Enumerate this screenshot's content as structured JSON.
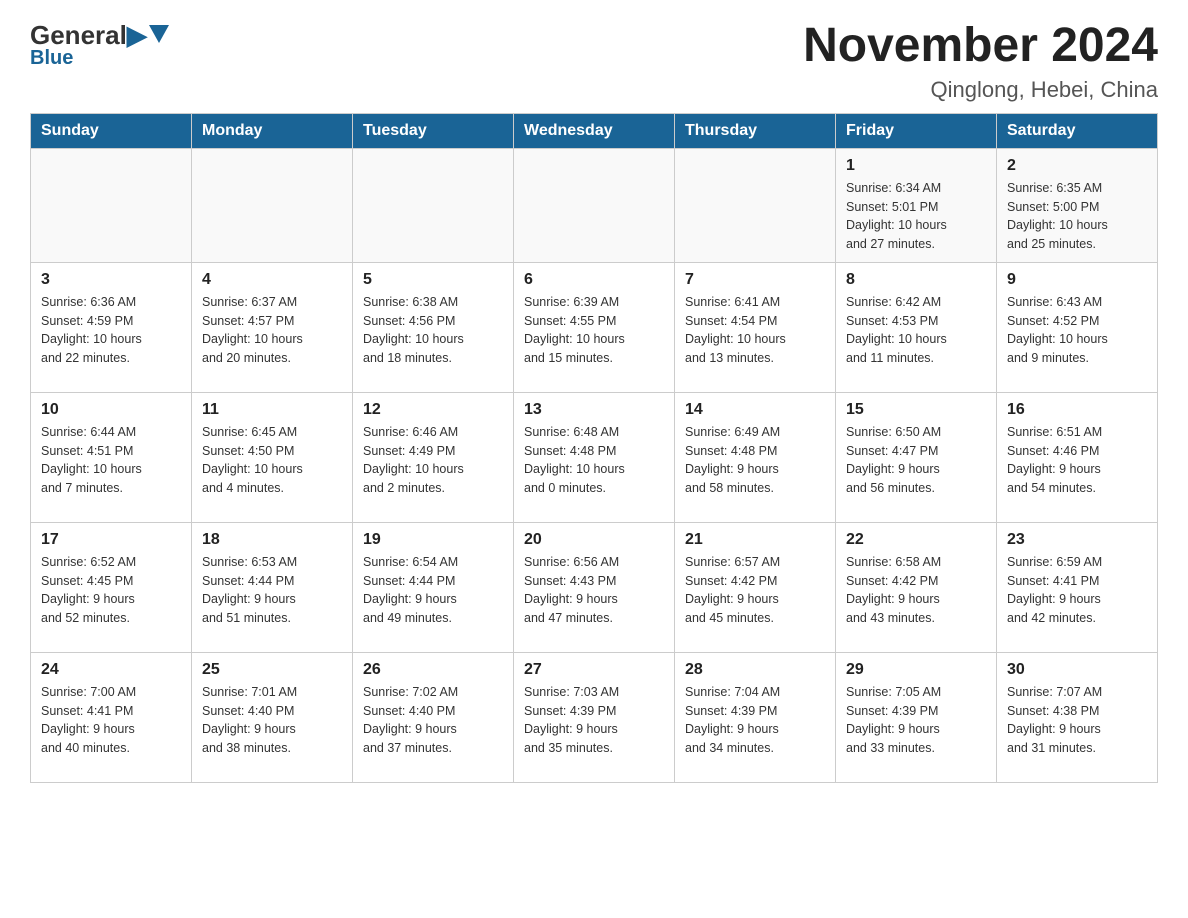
{
  "header": {
    "logo": {
      "general": "General",
      "blue": "Blue",
      "blue_label": "Blue"
    },
    "month_year": "November 2024",
    "location": "Qinglong, Hebei, China"
  },
  "weekdays": [
    "Sunday",
    "Monday",
    "Tuesday",
    "Wednesday",
    "Thursday",
    "Friday",
    "Saturday"
  ],
  "weeks": [
    [
      {
        "day": "",
        "info": ""
      },
      {
        "day": "",
        "info": ""
      },
      {
        "day": "",
        "info": ""
      },
      {
        "day": "",
        "info": ""
      },
      {
        "day": "",
        "info": ""
      },
      {
        "day": "1",
        "info": "Sunrise: 6:34 AM\nSunset: 5:01 PM\nDaylight: 10 hours\nand 27 minutes."
      },
      {
        "day": "2",
        "info": "Sunrise: 6:35 AM\nSunset: 5:00 PM\nDaylight: 10 hours\nand 25 minutes."
      }
    ],
    [
      {
        "day": "3",
        "info": "Sunrise: 6:36 AM\nSunset: 4:59 PM\nDaylight: 10 hours\nand 22 minutes."
      },
      {
        "day": "4",
        "info": "Sunrise: 6:37 AM\nSunset: 4:57 PM\nDaylight: 10 hours\nand 20 minutes."
      },
      {
        "day": "5",
        "info": "Sunrise: 6:38 AM\nSunset: 4:56 PM\nDaylight: 10 hours\nand 18 minutes."
      },
      {
        "day": "6",
        "info": "Sunrise: 6:39 AM\nSunset: 4:55 PM\nDaylight: 10 hours\nand 15 minutes."
      },
      {
        "day": "7",
        "info": "Sunrise: 6:41 AM\nSunset: 4:54 PM\nDaylight: 10 hours\nand 13 minutes."
      },
      {
        "day": "8",
        "info": "Sunrise: 6:42 AM\nSunset: 4:53 PM\nDaylight: 10 hours\nand 11 minutes."
      },
      {
        "day": "9",
        "info": "Sunrise: 6:43 AM\nSunset: 4:52 PM\nDaylight: 10 hours\nand 9 minutes."
      }
    ],
    [
      {
        "day": "10",
        "info": "Sunrise: 6:44 AM\nSunset: 4:51 PM\nDaylight: 10 hours\nand 7 minutes."
      },
      {
        "day": "11",
        "info": "Sunrise: 6:45 AM\nSunset: 4:50 PM\nDaylight: 10 hours\nand 4 minutes."
      },
      {
        "day": "12",
        "info": "Sunrise: 6:46 AM\nSunset: 4:49 PM\nDaylight: 10 hours\nand 2 minutes."
      },
      {
        "day": "13",
        "info": "Sunrise: 6:48 AM\nSunset: 4:48 PM\nDaylight: 10 hours\nand 0 minutes."
      },
      {
        "day": "14",
        "info": "Sunrise: 6:49 AM\nSunset: 4:48 PM\nDaylight: 9 hours\nand 58 minutes."
      },
      {
        "day": "15",
        "info": "Sunrise: 6:50 AM\nSunset: 4:47 PM\nDaylight: 9 hours\nand 56 minutes."
      },
      {
        "day": "16",
        "info": "Sunrise: 6:51 AM\nSunset: 4:46 PM\nDaylight: 9 hours\nand 54 minutes."
      }
    ],
    [
      {
        "day": "17",
        "info": "Sunrise: 6:52 AM\nSunset: 4:45 PM\nDaylight: 9 hours\nand 52 minutes."
      },
      {
        "day": "18",
        "info": "Sunrise: 6:53 AM\nSunset: 4:44 PM\nDaylight: 9 hours\nand 51 minutes."
      },
      {
        "day": "19",
        "info": "Sunrise: 6:54 AM\nSunset: 4:44 PM\nDaylight: 9 hours\nand 49 minutes."
      },
      {
        "day": "20",
        "info": "Sunrise: 6:56 AM\nSunset: 4:43 PM\nDaylight: 9 hours\nand 47 minutes."
      },
      {
        "day": "21",
        "info": "Sunrise: 6:57 AM\nSunset: 4:42 PM\nDaylight: 9 hours\nand 45 minutes."
      },
      {
        "day": "22",
        "info": "Sunrise: 6:58 AM\nSunset: 4:42 PM\nDaylight: 9 hours\nand 43 minutes."
      },
      {
        "day": "23",
        "info": "Sunrise: 6:59 AM\nSunset: 4:41 PM\nDaylight: 9 hours\nand 42 minutes."
      }
    ],
    [
      {
        "day": "24",
        "info": "Sunrise: 7:00 AM\nSunset: 4:41 PM\nDaylight: 9 hours\nand 40 minutes."
      },
      {
        "day": "25",
        "info": "Sunrise: 7:01 AM\nSunset: 4:40 PM\nDaylight: 9 hours\nand 38 minutes."
      },
      {
        "day": "26",
        "info": "Sunrise: 7:02 AM\nSunset: 4:40 PM\nDaylight: 9 hours\nand 37 minutes."
      },
      {
        "day": "27",
        "info": "Sunrise: 7:03 AM\nSunset: 4:39 PM\nDaylight: 9 hours\nand 35 minutes."
      },
      {
        "day": "28",
        "info": "Sunrise: 7:04 AM\nSunset: 4:39 PM\nDaylight: 9 hours\nand 34 minutes."
      },
      {
        "day": "29",
        "info": "Sunrise: 7:05 AM\nSunset: 4:39 PM\nDaylight: 9 hours\nand 33 minutes."
      },
      {
        "day": "30",
        "info": "Sunrise: 7:07 AM\nSunset: 4:38 PM\nDaylight: 9 hours\nand 31 minutes."
      }
    ]
  ]
}
